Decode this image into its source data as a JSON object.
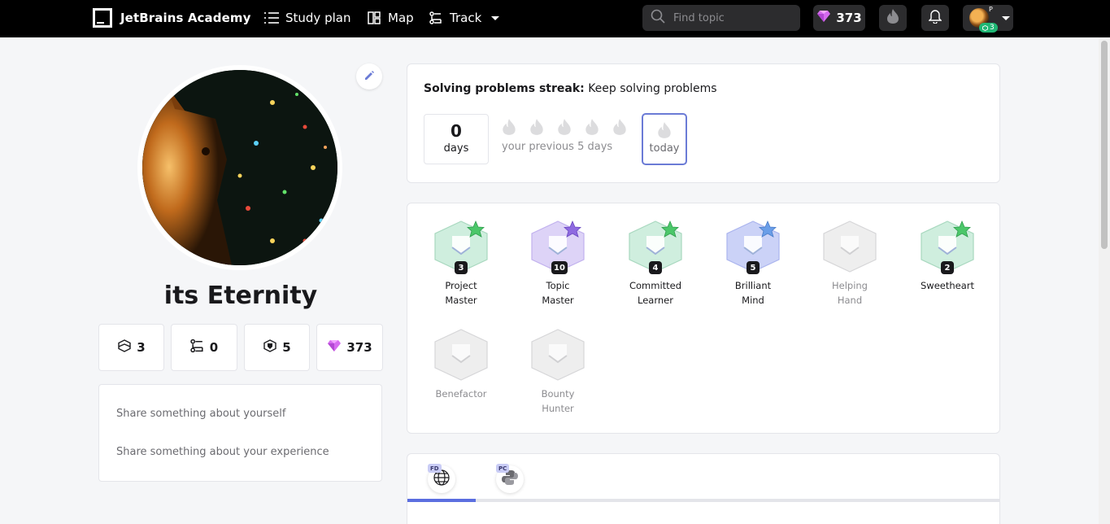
{
  "nav": {
    "brand": "JetBrains Academy",
    "study_plan": "Study plan",
    "map": "Map",
    "track": "Track",
    "search_placeholder": "Find topic",
    "gems": "373",
    "avatar_badge_count": "3",
    "avatar_badge_letter": "P",
    "icons": [
      "study-plan-icon",
      "map-icon",
      "track-icon",
      "search-icon",
      "gem-icon",
      "flame-icon",
      "bell-icon"
    ]
  },
  "profile": {
    "name": "its Eternity",
    "stats": [
      {
        "icon": "project-icon",
        "value": "3"
      },
      {
        "icon": "track-icon",
        "value": "0"
      },
      {
        "icon": "badge-icon",
        "value": "5"
      },
      {
        "icon": "gem-icon",
        "value": "373"
      }
    ],
    "about_prompt": "Share something about yourself",
    "experience_prompt": "Share something about your experience"
  },
  "streak": {
    "title": "Solving problems streak:",
    "subtitle": "Keep solving problems",
    "days_value": "0",
    "days_label": "days",
    "previous_label": "your previous 5 days",
    "today_label": "today"
  },
  "badges": [
    {
      "name_line1": "Project",
      "name_line2": "Master",
      "level": "3",
      "hex_color": "#cfeede",
      "star_color": "#4cc76a",
      "earned": true
    },
    {
      "name_line1": "Topic",
      "name_line2": "Master",
      "level": "10",
      "hex_color": "#ddd3f7",
      "star_color": "#8e6ae0",
      "earned": true
    },
    {
      "name_line1": "Committed",
      "name_line2": "Learner",
      "level": "4",
      "hex_color": "#cfeede",
      "star_color": "#4cc76a",
      "earned": true
    },
    {
      "name_line1": "Brilliant",
      "name_line2": "Mind",
      "level": "5",
      "hex_color": "#cbd2f7",
      "star_color": "#6a9ee8",
      "earned": true
    },
    {
      "name_line1": "Helping",
      "name_line2": "Hand",
      "level": "",
      "hex_color": "#eeeeee",
      "star_color": "",
      "earned": false
    },
    {
      "name_line1": "Sweetheart",
      "name_line2": "",
      "level": "2",
      "hex_color": "#cfeede",
      "star_color": "#4cc76a",
      "earned": true
    },
    {
      "name_line1": "Benefactor",
      "name_line2": "",
      "level": "",
      "hex_color": "#eeeeee",
      "star_color": "",
      "earned": false
    },
    {
      "name_line1": "Bounty",
      "name_line2": "Hunter",
      "level": "",
      "hex_color": "#eeeeee",
      "star_color": "",
      "earned": false
    }
  ],
  "tracks": [
    {
      "tag": "FD",
      "icon": "globe-icon"
    },
    {
      "tag": "PC",
      "icon": "python-icon"
    }
  ],
  "colors": {
    "topbar": "#000000",
    "accent": "#5b6ee0",
    "gem": "#d66bf0",
    "page_bg": "#f5f6f8"
  }
}
